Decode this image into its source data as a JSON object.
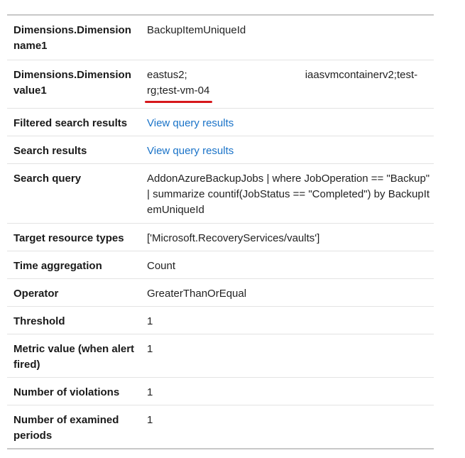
{
  "rows": [
    {
      "label": "Dimensions.Dimension name1",
      "value": "BackupItemUniqueId"
    },
    {
      "label": "Dimensions.Dimension value1",
      "value_part1": "eastus2;",
      "value_part2": "iaasvmcontainerv2;test-",
      "value_part3": "rg;test-vm-04"
    },
    {
      "label": "Filtered search results",
      "link": "View query results"
    },
    {
      "label": "Search results",
      "link": "View query results"
    },
    {
      "label": "Search query",
      "value": "AddonAzureBackupJobs | where JobOperation == \"Backup\" | summarize countif(JobStatus == \"Completed\") by BackupItemUniqueId"
    },
    {
      "label": "Target resource types",
      "value": "['Microsoft.RecoveryServices/vaults']"
    },
    {
      "label": "Time aggregation",
      "value": "Count"
    },
    {
      "label": "Operator",
      "value": "GreaterThanOrEqual"
    },
    {
      "label": "Threshold",
      "value": "1"
    },
    {
      "label": "Metric value (when alert fired)",
      "value": "1"
    },
    {
      "label": "Number of violations",
      "value": "1"
    },
    {
      "label": "Number of examined periods",
      "value": "1"
    }
  ],
  "colors": {
    "link": "#1a73c8",
    "highlight": "#d6171b",
    "border": "#c8c8c8"
  }
}
